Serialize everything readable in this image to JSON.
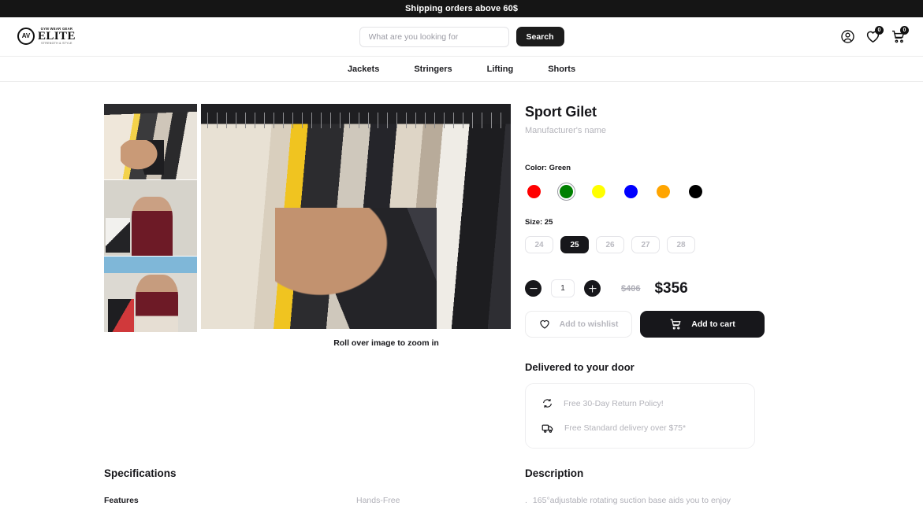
{
  "announcement": {
    "text": "Shipping orders above 60$"
  },
  "header": {
    "logo": {
      "top_text": "GYM WEAR GEAR",
      "main_text": "ELITE",
      "sub_text": "STRENGTH & STYLE",
      "mark_text": "AV"
    },
    "search": {
      "placeholder": "What are you looking for",
      "value": "",
      "button_label": "Search"
    },
    "icons": {
      "account": {
        "name": "account-icon"
      },
      "wishlist": {
        "name": "wishlist-icon",
        "badge": "0"
      },
      "cart": {
        "name": "cart-icon",
        "badge": "0"
      }
    }
  },
  "nav": {
    "items": [
      {
        "label": "Jackets"
      },
      {
        "label": "Stringers"
      },
      {
        "label": "Lifting"
      },
      {
        "label": "Shorts"
      }
    ]
  },
  "gallery": {
    "zoom_hint": "Roll over image to zoom in",
    "thumbnails": [
      {
        "alt": "Hand browsing clothing rack with watch",
        "selected": true
      },
      {
        "alt": "Woman in maroon coat holding shopping bags",
        "selected": false
      },
      {
        "alt": "Woman with sunglasses and shopping bags outdoors",
        "selected": false
      }
    ],
    "main_image": {
      "alt": "Person browsing jackets on a clothing rack"
    }
  },
  "product": {
    "title": "Sport Gilet",
    "brand": "Manufacturer's name",
    "color_label": "Color: Green",
    "colors": [
      {
        "name": "Red",
        "hex": "#FF0000",
        "selected": false
      },
      {
        "name": "Green",
        "hex": "#008000",
        "selected": true
      },
      {
        "name": "Yellow",
        "hex": "#FFFF00",
        "selected": false
      },
      {
        "name": "Blue",
        "hex": "#0000FF",
        "selected": false
      },
      {
        "name": "Orange",
        "hex": "#FFA500",
        "selected": false
      },
      {
        "name": "Black",
        "hex": "#000000",
        "selected": false
      }
    ],
    "size_label": "Size: 25",
    "sizes": [
      {
        "label": "24",
        "selected": false
      },
      {
        "label": "25",
        "selected": true
      },
      {
        "label": "26",
        "selected": false
      },
      {
        "label": "27",
        "selected": false
      },
      {
        "label": "28",
        "selected": false
      }
    ],
    "quantity": "1",
    "old_price": "$406",
    "price": "$356",
    "wishlist_label": "Add to wishlist",
    "cart_label": "Add to cart"
  },
  "delivery": {
    "title": "Delivered to your door",
    "rows": [
      {
        "icon": "return-icon",
        "text": "Free 30-Day Return Policy!"
      },
      {
        "icon": "truck-icon",
        "text": "Free Standard delivery over $75*"
      }
    ]
  },
  "specifications": {
    "title": "Specifications",
    "rows": [
      {
        "key": "Features",
        "value": "Hands-Free"
      }
    ]
  },
  "description": {
    "title": "Description",
    "bullets": [
      "165°adjustable rotating suction base aids you to enjoy"
    ]
  }
}
